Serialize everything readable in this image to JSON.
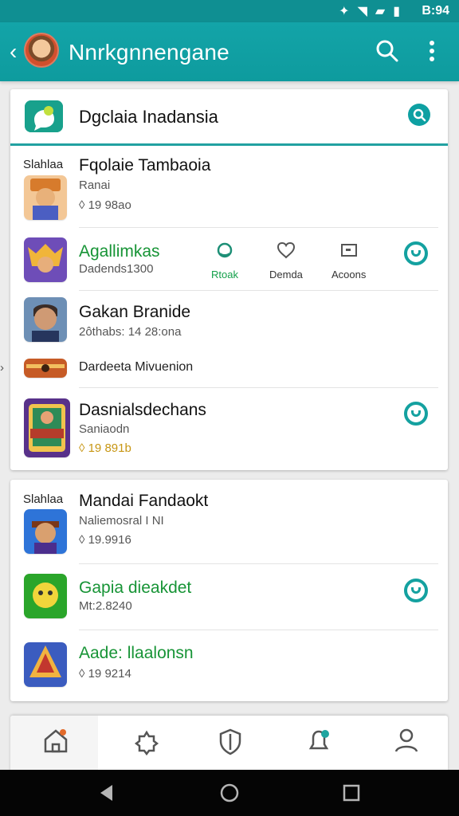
{
  "status_bar": {
    "time": "B:94",
    "icons": [
      "bluetooth-icon",
      "wifi-icon",
      "signal-icon",
      "battery-icon"
    ]
  },
  "app_bar": {
    "title": "Nnrkgnnengane",
    "actions": [
      "search-icon",
      "more-icon"
    ]
  },
  "card1": {
    "header_title": "Dgclaia Inadansia",
    "rows": [
      {
        "side_label": "Slahlaa",
        "title": "Fqolaie Tambaoia",
        "subtitle": "Ranai",
        "meta": "19 98ao"
      },
      {
        "title": "Agallimkas",
        "subtitle": "Dadends1300",
        "actions": [
          {
            "label": "Rtoak",
            "icon": "tab-icon"
          },
          {
            "label": "Demda",
            "icon": "heart-icon"
          },
          {
            "label": "Acoons",
            "icon": "screen-icon"
          }
        ]
      },
      {
        "title": "Gakan Branide",
        "subtitle": "2ôthabs: 14 28:ona"
      },
      {
        "title": "Dardeeta Mivuenion"
      },
      {
        "title": "Dasnialsdechans",
        "subtitle": "Saniaodn",
        "meta": "19 891b"
      }
    ]
  },
  "card2": {
    "rows": [
      {
        "side_label": "Slahlaa",
        "title": "Mandai Fandaokt",
        "subtitle": "Naliemosral I NI",
        "meta": "19.9916"
      },
      {
        "title": "Gapia dieakdet",
        "subtitle": "Mt:2.8240"
      },
      {
        "title": "Aade: llaalonsn",
        "meta": "19 9214"
      }
    ]
  },
  "bottom_nav": [
    "home-icon",
    "puzzle-icon",
    "shield-icon",
    "notification-icon",
    "profile-icon"
  ],
  "colors": {
    "primary": "#0ea0a2",
    "green": "#179436",
    "orange": "#c79613",
    "background": "#ececec"
  }
}
